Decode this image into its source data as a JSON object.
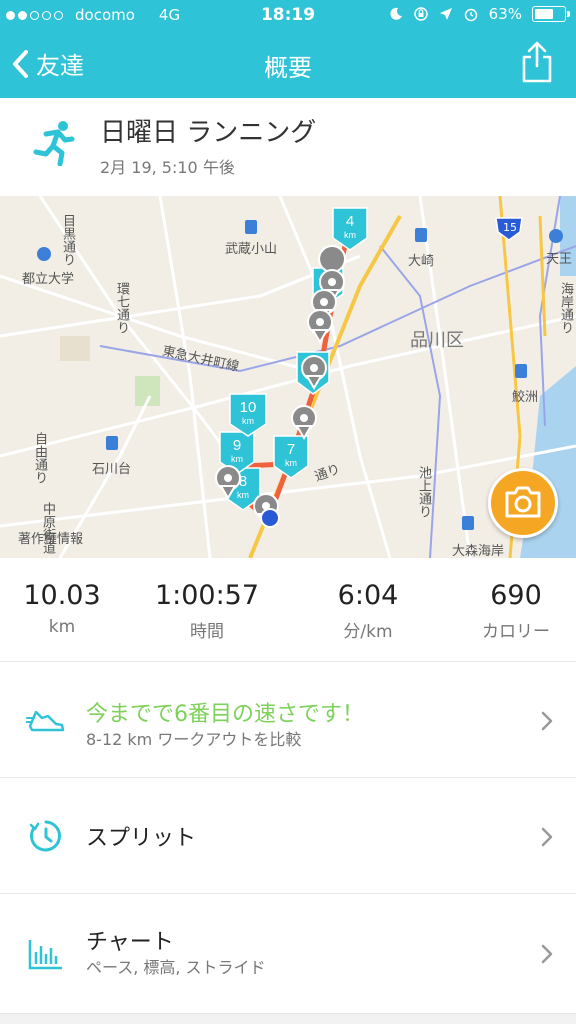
{
  "status_bar": {
    "carrier": "docomo",
    "network": "4G",
    "time": "18:19",
    "battery_text": "63%",
    "battery_level": 0.63,
    "signal_bars_filled": 2,
    "signal_bars_total": 5,
    "icons": [
      "moon-icon",
      "rotation-lock-icon",
      "location-arrow-icon",
      "alarm-icon"
    ]
  },
  "nav": {
    "back_label": "友達",
    "title": "概要",
    "share_icon": "share-icon"
  },
  "activity": {
    "title": "日曜日 ランニング",
    "date": "2月 19, 5:10 午後",
    "icon": "runner-icon"
  },
  "map": {
    "labels": {
      "meguro": "目黒通り",
      "musashikoyama": "武蔵小山",
      "toritsu": "都立大学",
      "kan7": "環七通り",
      "tokyu": "東急大井町線",
      "jiyu": "自由通り",
      "ishikawadai": "石川台",
      "nakahara": "中原街道",
      "copyright": "著作権情報",
      "osaki": "大崎",
      "shinagawa": "品川区",
      "route15": "15",
      "tenno": "天王",
      "kaigan": "海岸通り",
      "samezu": "鮫洲",
      "ikegami": "池上通り",
      "omori": "大森海岸",
      "ikedori": "通り"
    },
    "markers": [
      "4",
      "7",
      "9",
      "10",
      "8"
    ],
    "marker_unit": "km",
    "accent": "#2ec3d6",
    "route_color": "#f0623c",
    "camera_icon": "camera-icon"
  },
  "stats": [
    {
      "value": "10.03",
      "unit": "km"
    },
    {
      "value": "1:00:57",
      "unit": "時間"
    },
    {
      "value": "6:04",
      "unit": "分/km"
    },
    {
      "value": "690",
      "unit": "カロリー"
    }
  ],
  "rows": {
    "compare": {
      "title": "今までで6番目の速さです！",
      "subtitle": "8-12 km ワークアウトを比較",
      "icon": "shoe-icon"
    },
    "splits": {
      "title": "スプリット",
      "icon": "stopwatch-icon"
    },
    "charts": {
      "title": "チャート",
      "subtitle": "ペース, 標高, ストライド",
      "icon": "bar-chart-icon"
    }
  },
  "colors": {
    "brand": "#2ec3d6",
    "highlight": "#7ed15b",
    "camera": "#f5a623"
  }
}
